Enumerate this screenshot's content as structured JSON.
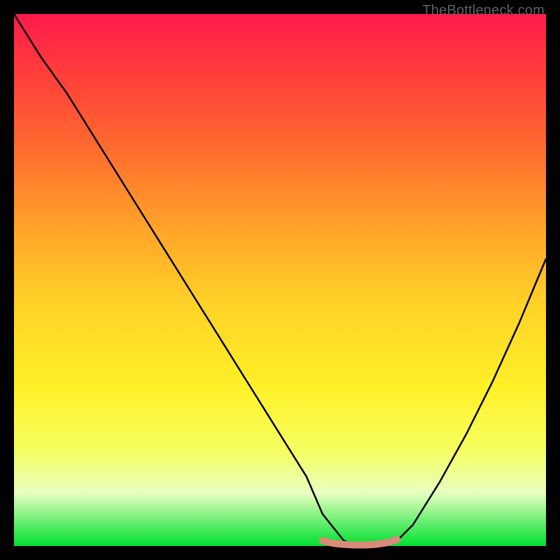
{
  "watermark": "TheBottleneck.com",
  "chart_data": {
    "type": "line",
    "title": "",
    "xlabel": "",
    "ylabel": "",
    "xlim": [
      0,
      100
    ],
    "ylim": [
      0,
      100
    ],
    "grid": false,
    "legend": false,
    "series": [
      {
        "name": "bottleneck-curve",
        "color": "#000000",
        "x": [
          0,
          5,
          10,
          15,
          20,
          25,
          30,
          35,
          40,
          45,
          50,
          55,
          58,
          62,
          65,
          68,
          72,
          75,
          80,
          85,
          90,
          95,
          100
        ],
        "y": [
          100,
          92,
          85,
          77,
          69,
          61,
          53,
          45,
          37,
          29,
          21,
          13,
          6,
          1,
          0,
          0,
          1,
          4,
          12,
          21,
          31,
          42,
          54
        ]
      }
    ],
    "highlight_segment": {
      "name": "optimal-zone-marker",
      "color": "#d98a7a",
      "x": [
        58,
        60,
        62,
        64,
        66,
        68,
        70,
        72
      ],
      "y": [
        1.0,
        0.5,
        0.3,
        0.2,
        0.2,
        0.3,
        0.6,
        1.2
      ]
    },
    "gradient_stops": [
      {
        "pos": 0,
        "color": "#ff1a4b"
      },
      {
        "pos": 10,
        "color": "#ff3a3c"
      },
      {
        "pos": 25,
        "color": "#ff6a2f"
      },
      {
        "pos": 40,
        "color": "#ffa329"
      },
      {
        "pos": 55,
        "color": "#ffd327"
      },
      {
        "pos": 70,
        "color": "#fff028"
      },
      {
        "pos": 82,
        "color": "#f6ff60"
      },
      {
        "pos": 90,
        "color": "#e8ffc0"
      },
      {
        "pos": 100,
        "color": "#00e030"
      }
    ]
  }
}
